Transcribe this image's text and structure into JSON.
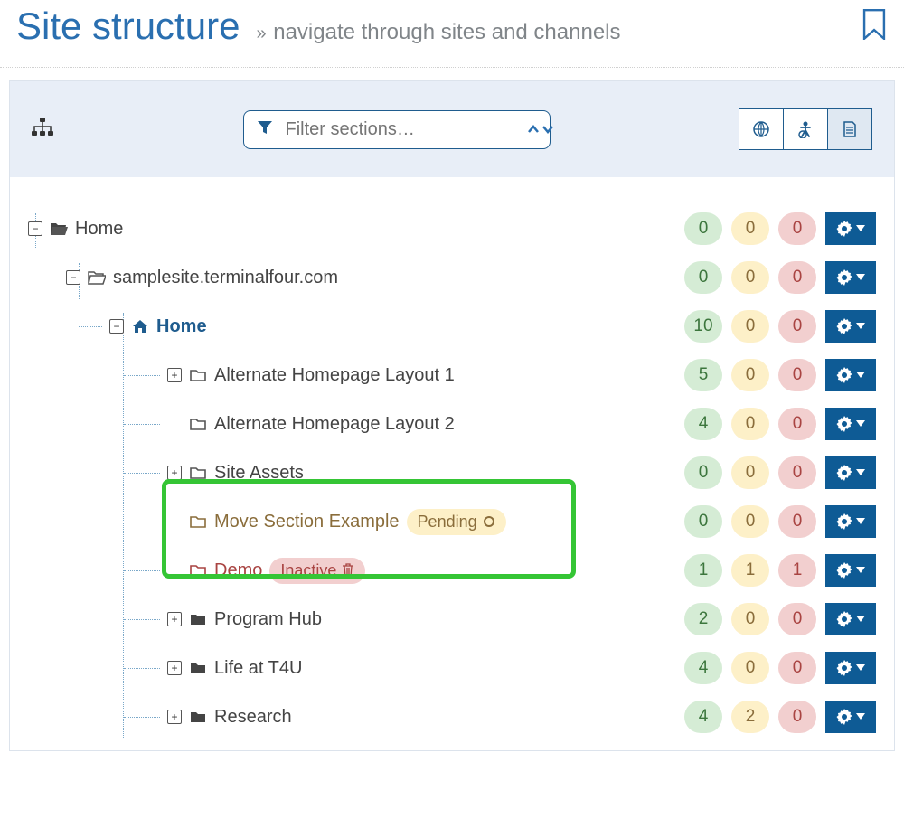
{
  "header": {
    "title": "Site structure",
    "subtitle": "navigate through sites and channels",
    "chevrons": "»"
  },
  "filter": {
    "placeholder": "Filter sections…"
  },
  "badges": {
    "pending": "Pending",
    "inactive": "Inactive"
  },
  "tree": [
    {
      "level": 0,
      "toggle": "minus",
      "icon": "folder-open-solid",
      "label": "Home",
      "approved": 0,
      "pending": 0,
      "inactive": 0
    },
    {
      "level": 1,
      "toggle": "minus",
      "icon": "folder-open-outline",
      "label": "samplesite.terminalfour.com",
      "approved": 0,
      "pending": 0,
      "inactive": 0
    },
    {
      "level": 2,
      "toggle": "minus",
      "icon": "home",
      "label": "Home",
      "bold": true,
      "approved": 10,
      "pending": 0,
      "inactive": 0
    },
    {
      "level": 3,
      "toggle": "plus",
      "icon": "folder-outline",
      "label": "Alternate Homepage Layout 1",
      "approved": 5,
      "pending": 0,
      "inactive": 0
    },
    {
      "level": 3,
      "toggle": "none",
      "icon": "folder-outline",
      "label": "Alternate Homepage Layout 2",
      "approved": 4,
      "pending": 0,
      "inactive": 0
    },
    {
      "level": 3,
      "toggle": "plus",
      "icon": "folder-outline",
      "label": "Site Assets",
      "approved": 0,
      "pending": 0,
      "inactive": 0
    },
    {
      "level": 3,
      "toggle": "none",
      "icon": "folder-outline-pending",
      "label": "Move Section Example",
      "status": "pending",
      "approved": 0,
      "pending": 0,
      "inactive": 0
    },
    {
      "level": 3,
      "toggle": "none",
      "icon": "folder-outline-inactive",
      "label": "Demo",
      "status": "inactive",
      "approved": 1,
      "pending": 1,
      "inactive": 1
    },
    {
      "level": 3,
      "toggle": "plus",
      "icon": "folder-solid",
      "label": "Program Hub",
      "approved": 2,
      "pending": 0,
      "inactive": 0
    },
    {
      "level": 3,
      "toggle": "plus",
      "icon": "folder-solid",
      "label": "Life at T4U",
      "approved": 4,
      "pending": 0,
      "inactive": 0
    },
    {
      "level": 3,
      "toggle": "plus",
      "icon": "folder-solid",
      "label": "Research",
      "approved": 4,
      "pending": 2,
      "inactive": 0
    }
  ],
  "colors": {
    "brand": "#1f5c8e",
    "action": "#0e5b95",
    "green_bg": "#d5ecd5",
    "yellow_bg": "#fdf0c8",
    "red_bg": "#f2cfcf",
    "highlight": "#35c535"
  }
}
